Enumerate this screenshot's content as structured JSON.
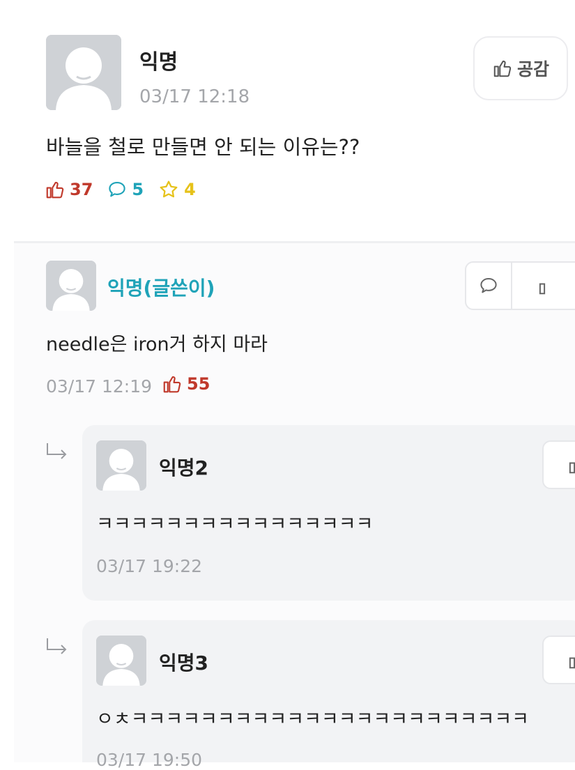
{
  "post": {
    "author": "익명",
    "time": "03/17 12:18",
    "like_button_label": "공감",
    "body": "바늘을 철로 만들면 안 되는 이유는??",
    "stats": {
      "likes": "37",
      "comments": "5",
      "scraps": "4"
    }
  },
  "comments": [
    {
      "author": "익명(글쓴이)",
      "body": "needle은 iron거 하지 마라",
      "time": "03/17 12:19",
      "likes": "55"
    }
  ],
  "replies": [
    {
      "author": "익명2",
      "body": "ㅋㅋㅋㅋㅋㅋㅋㅋㅋㅋㅋㅋㅋㅋㅋㅋ",
      "time": "03/17 19:22"
    },
    {
      "author": "익명3",
      "body": "ㅇㅊㅋㅋㅋㅋㅋㅋㅋㅋㅋㅋㅋㅋㅋㅋㅋㅋㅋㅋㅋㅋㅋㅋㅋ",
      "time": "03/17 19:50"
    }
  ],
  "colors": {
    "like_red": "#c0392b",
    "comment_teal": "#1fa3b8",
    "scrap_yellow": "#e6c21a",
    "writer_teal": "#1fa3b8"
  },
  "icons": [
    "thumbs-up-icon",
    "speech-bubble-icon",
    "star-icon",
    "reply-arrow-icon",
    "avatar-icon"
  ]
}
